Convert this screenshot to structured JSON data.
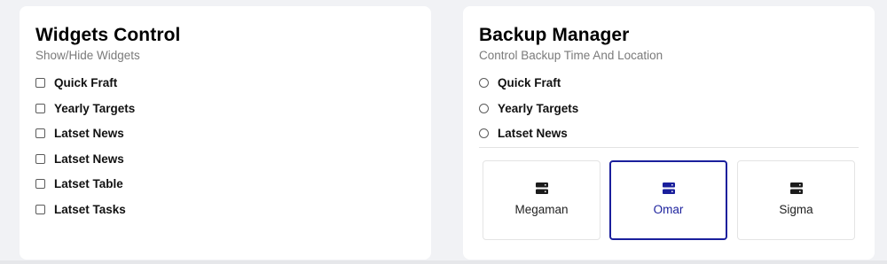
{
  "widgets": {
    "title": "Widgets Control",
    "subtitle": "Show/Hide Widgets",
    "options": [
      "Quick Fraft",
      "Yearly Targets",
      "Latset News",
      "Latset News",
      "Latset Table",
      "Latset Tasks"
    ]
  },
  "backup": {
    "title": "Backup Manager",
    "subtitle": "Control Backup Time And Location",
    "times": [
      "Quick Fraft",
      "Yearly Targets",
      "Latset News"
    ],
    "locations": [
      {
        "label": "Megaman",
        "icon": "server-icon",
        "selected": false
      },
      {
        "label": "Omar",
        "icon": "server-icon",
        "selected": true
      },
      {
        "label": "Sigma",
        "icon": "server-icon",
        "selected": false
      }
    ]
  },
  "colors": {
    "accent": "#1a1f9c",
    "page_background": "#f1f2f5",
    "card_background": "#ffffff"
  }
}
